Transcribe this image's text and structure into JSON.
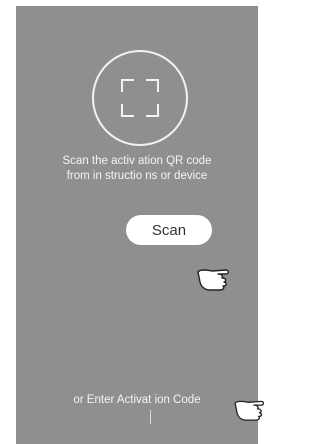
{
  "scan_prompt": {
    "line1": "Scan the activ ation QR code",
    "line2": "from in  structio ns or device"
  },
  "scan_button": {
    "label": "Scan"
  },
  "enter_code_link": {
    "label": "or Enter Activat ion Code"
  },
  "icons": {
    "scan_frame": "qr-scan-frame-icon",
    "pointer_hand": "pointing-hand-icon"
  },
  "colors": {
    "background": "#8f8f8f",
    "foreground": "#f4f4f4",
    "button": "#ffffff"
  }
}
